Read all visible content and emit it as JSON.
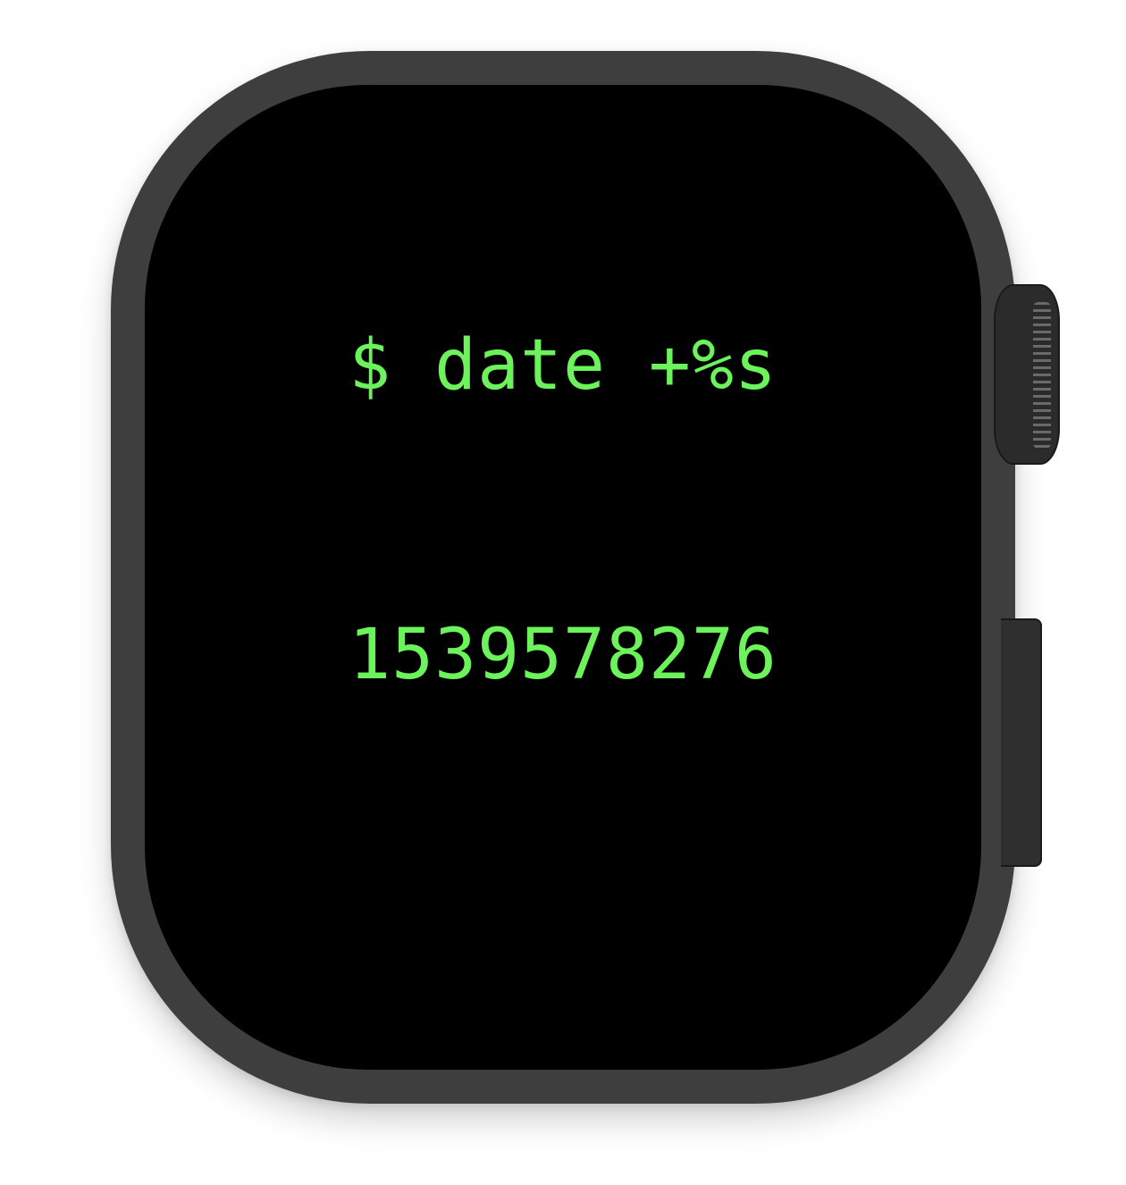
{
  "terminal": {
    "lines": [
      "$ date +%s",
      "1539578276"
    ],
    "text_color": "#6cf25a",
    "background_color": "#000000"
  },
  "device": {
    "case_color": "#3e3e3e",
    "crown_color": "#2b2b2b",
    "button_color": "#2f2f2f"
  }
}
